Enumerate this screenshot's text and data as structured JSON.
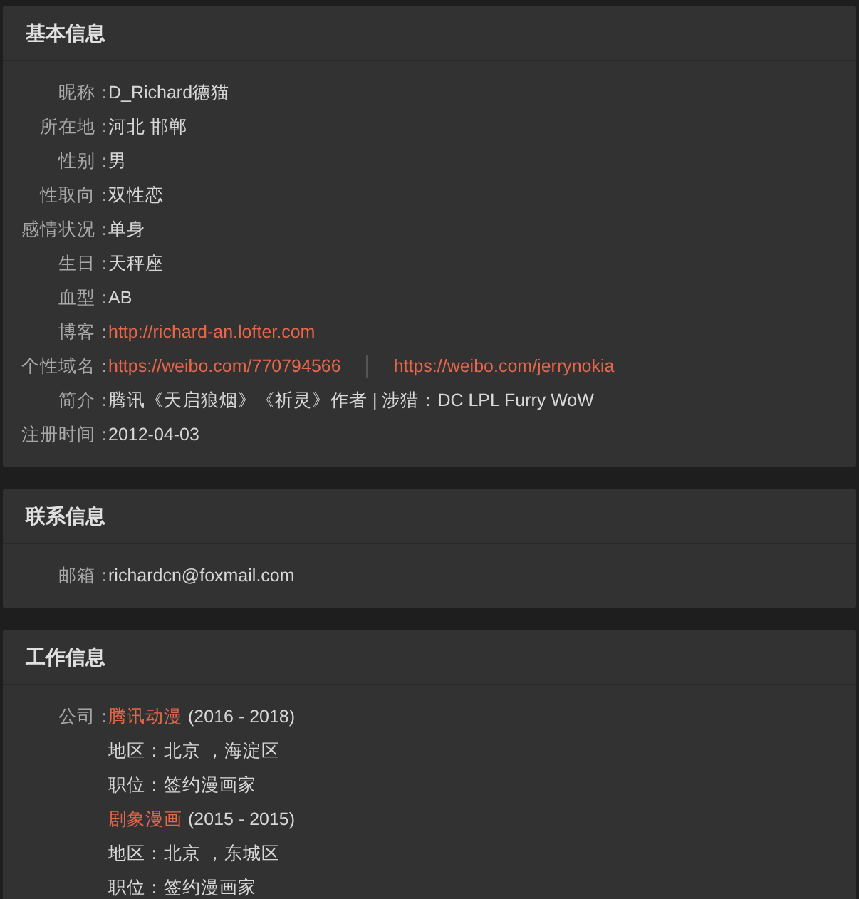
{
  "sections": [
    {
      "title": "基本信息",
      "rows": [
        {
          "label": "昵称：",
          "values": [
            {
              "kind": "text",
              "text": "D_Richard德猫"
            }
          ]
        },
        {
          "label": "所在地：",
          "values": [
            {
              "kind": "text",
              "text": "河北 邯郸"
            }
          ]
        },
        {
          "label": "性别：",
          "values": [
            {
              "kind": "text",
              "text": "男"
            }
          ]
        },
        {
          "label": "性取向：",
          "values": [
            {
              "kind": "text",
              "text": "双性恋"
            }
          ]
        },
        {
          "label": "感情状况：",
          "values": [
            {
              "kind": "text",
              "text": "单身"
            }
          ]
        },
        {
          "label": "生日：",
          "values": [
            {
              "kind": "text",
              "text": "天秤座"
            }
          ]
        },
        {
          "label": "血型：",
          "values": [
            {
              "kind": "text",
              "text": "AB"
            }
          ]
        },
        {
          "label": "博客：",
          "values": [
            {
              "kind": "link",
              "text": "http://richard-an.lofter.com"
            }
          ]
        },
        {
          "label": "个性域名：",
          "values": [
            {
              "kind": "link",
              "text": "https://weibo.com/770794566"
            },
            {
              "kind": "link",
              "text": "https://weibo.com/jerrynokia"
            }
          ]
        },
        {
          "label": "简介：",
          "values": [
            {
              "kind": "text",
              "text": "腾讯《天启狼烟》《祈灵》作者 | 涉猎：DC LPL Furry WoW"
            }
          ]
        },
        {
          "label": "注册时间：",
          "values": [
            {
              "kind": "text",
              "text": "2012-04-03"
            }
          ]
        }
      ]
    },
    {
      "title": "联系信息",
      "rows": [
        {
          "label": "邮箱：",
          "values": [
            {
              "kind": "text",
              "text": "richardcn@foxmail.com"
            }
          ]
        }
      ]
    },
    {
      "title": "工作信息",
      "rows": [
        {
          "label": "公司：",
          "values": [
            {
              "kind": "link",
              "text": "腾讯动漫"
            },
            {
              "kind": "text",
              "text": "(2016 - 2018)"
            }
          ]
        },
        {
          "values": [
            {
              "kind": "text",
              "text": "地区：北京 ，海淀区"
            }
          ]
        },
        {
          "values": [
            {
              "kind": "text",
              "text": "职位：签约漫画家"
            }
          ]
        },
        {
          "values": [
            {
              "kind": "link",
              "text": "剧象漫画"
            },
            {
              "kind": "text",
              "text": "(2015 - 2015)"
            }
          ]
        },
        {
          "values": [
            {
              "kind": "text",
              "text": "地区：北京 ，东城区"
            }
          ]
        },
        {
          "values": [
            {
              "kind": "text",
              "text": "职位：签约漫画家"
            }
          ]
        }
      ]
    }
  ]
}
